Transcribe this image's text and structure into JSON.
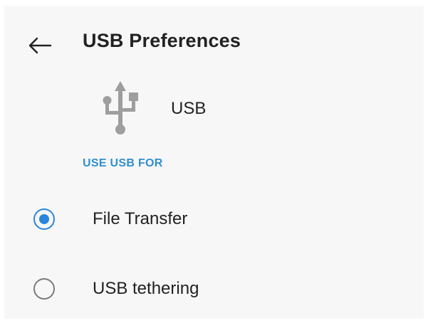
{
  "header": {
    "title": "USB Preferences",
    "back_icon": "arrow-back-icon"
  },
  "usb": {
    "icon": "usb-icon",
    "label": "USB"
  },
  "section": {
    "title": "USE USB FOR"
  },
  "options": [
    {
      "label": "File Transfer",
      "selected": true
    },
    {
      "label": "USB tethering",
      "selected": false
    }
  ],
  "colors": {
    "accent": "#2a86dc",
    "section_title": "#2f8fd1",
    "icon_gray": "#9e9e9e",
    "background": "#f7f7f7",
    "text": "#222222"
  }
}
